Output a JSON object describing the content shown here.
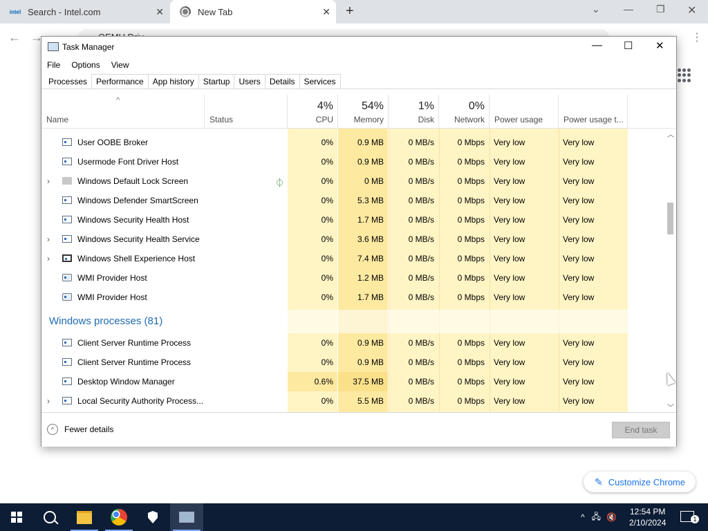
{
  "chrome": {
    "tabs": [
      {
        "label": "Search - Intel.com",
        "logo": "intel"
      },
      {
        "label": "New Tab"
      }
    ],
    "omnibox_text": "OEMU Driv",
    "customize_label": "Customize Chrome"
  },
  "taskmgr": {
    "title": "Task Manager",
    "menu": [
      "File",
      "Options",
      "View"
    ],
    "tabs": [
      "Processes",
      "Performance",
      "App history",
      "Startup",
      "Users",
      "Details",
      "Services"
    ],
    "columns": {
      "name": "Name",
      "status": "Status",
      "cpu": {
        "pct": "4%",
        "label": "CPU"
      },
      "memory": {
        "pct": "54%",
        "label": "Memory"
      },
      "disk": {
        "pct": "1%",
        "label": "Disk"
      },
      "network": {
        "pct": "0%",
        "label": "Network"
      },
      "power": "Power usage",
      "power_trend": "Power usage t..."
    },
    "rows": [
      {
        "name": "User OOBE Broker",
        "cpu": "0%",
        "mem": "0.9 MB",
        "disk": "0 MB/s",
        "net": "0 Mbps",
        "power": "Very low",
        "trend": "Very low"
      },
      {
        "name": "Usermode Font Driver Host",
        "cpu": "0%",
        "mem": "0.9 MB",
        "disk": "0 MB/s",
        "net": "0 Mbps",
        "power": "Very low",
        "trend": "Very low"
      },
      {
        "name": "Windows Default Lock Screen",
        "cpu": "0%",
        "mem": "0 MB",
        "disk": "0 MB/s",
        "net": "0 Mbps",
        "power": "Very low",
        "trend": "Very low"
      },
      {
        "name": "Windows Defender SmartScreen",
        "cpu": "0%",
        "mem": "5.3 MB",
        "disk": "0 MB/s",
        "net": "0 Mbps",
        "power": "Very low",
        "trend": "Very low"
      },
      {
        "name": "Windows Security Health Host",
        "cpu": "0%",
        "mem": "1.7 MB",
        "disk": "0 MB/s",
        "net": "0 Mbps",
        "power": "Very low",
        "trend": "Very low"
      },
      {
        "name": "Windows Security Health Service",
        "cpu": "0%",
        "mem": "3.6 MB",
        "disk": "0 MB/s",
        "net": "0 Mbps",
        "power": "Very low",
        "trend": "Very low"
      },
      {
        "name": "Windows Shell Experience Host",
        "cpu": "0%",
        "mem": "7.4 MB",
        "disk": "0 MB/s",
        "net": "0 Mbps",
        "power": "Very low",
        "trend": "Very low"
      },
      {
        "name": "WMI Provider Host",
        "cpu": "0%",
        "mem": "1.2 MB",
        "disk": "0 MB/s",
        "net": "0 Mbps",
        "power": "Very low",
        "trend": "Very low"
      },
      {
        "name": "WMI Provider Host",
        "cpu": "0%",
        "mem": "1.7 MB",
        "disk": "0 MB/s",
        "net": "0 Mbps",
        "power": "Very low",
        "trend": "Very low"
      },
      {
        "group": "Windows processes (81)"
      },
      {
        "name": "Client Server Runtime Process",
        "cpu": "0%",
        "mem": "0.9 MB",
        "disk": "0 MB/s",
        "net": "0 Mbps",
        "power": "Very low",
        "trend": "Very low"
      },
      {
        "name": "Client Server Runtime Process",
        "cpu": "0%",
        "mem": "0.9 MB",
        "disk": "0 MB/s",
        "net": "0 Mbps",
        "power": "Very low",
        "trend": "Very low"
      },
      {
        "name": "Desktop Window Manager",
        "cpu": "0.6%",
        "mem": "37.5 MB",
        "disk": "0 MB/s",
        "net": "0 Mbps",
        "power": "Very low",
        "trend": "Very low"
      },
      {
        "name": "Local Security Authority Process...",
        "cpu": "0%",
        "mem": "5.5 MB",
        "disk": "0 MB/s",
        "net": "0 Mbps",
        "power": "Very low",
        "trend": "Very low"
      }
    ],
    "footer": {
      "fewer": "Fewer details",
      "end_task": "End task"
    }
  },
  "taskbar": {
    "time": "12:54 PM",
    "date": "2/10/2024",
    "notifications": "1"
  },
  "colors": {
    "heat_light": "#fff4c4",
    "heat_med": "#fde9a0",
    "group_blue": "#1e6ab0",
    "taskbar": "#0c1d35"
  }
}
